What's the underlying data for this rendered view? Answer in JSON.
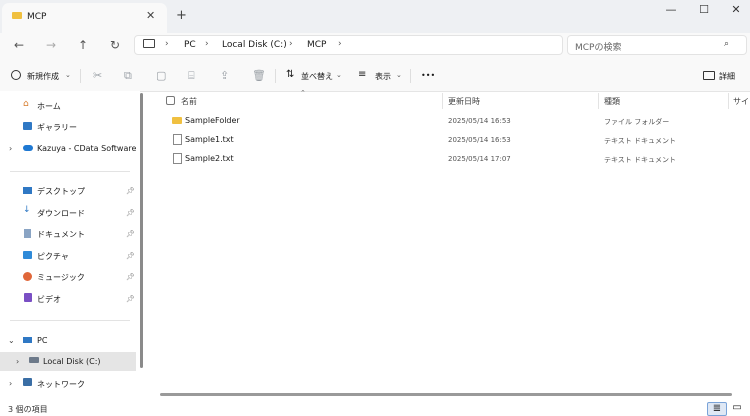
{
  "window": {
    "tab_title": "MCP",
    "new_tab": "+",
    "close_tab": "✕",
    "minimize": "—",
    "maximize": "☐",
    "close": "✕"
  },
  "nav": {
    "back": "←",
    "forward": "→",
    "up": "↑",
    "refresh": "↻"
  },
  "address": {
    "crumbs": [
      "PC",
      "Local Disk (C:)",
      "MCP"
    ],
    "search_placeholder": "MCPの検索"
  },
  "toolbar": {
    "new_label": "新規作成",
    "sort_label": "並べ替え",
    "view_label": "表示",
    "more_label": "•••",
    "details_label": "詳細"
  },
  "sidebar": {
    "items": [
      {
        "label": "ホーム",
        "icon": "home-icon"
      },
      {
        "label": "ギャラリー",
        "icon": "gallery-icon"
      },
      {
        "label": "Kazuya - CData Software",
        "icon": "cloud-icon"
      },
      {
        "label": "デスクトップ",
        "icon": "desktop-icon"
      },
      {
        "label": "ダウンロード",
        "icon": "download-icon"
      },
      {
        "label": "ドキュメント",
        "icon": "document-icon"
      },
      {
        "label": "ピクチャ",
        "icon": "pictures-icon"
      },
      {
        "label": "ミュージック",
        "icon": "music-icon"
      },
      {
        "label": "ビデオ",
        "icon": "video-icon"
      },
      {
        "label": "PC",
        "icon": "pc-icon"
      },
      {
        "label": "Local Disk (C:)",
        "icon": "drive-icon"
      },
      {
        "label": "ネットワーク",
        "icon": "network-icon"
      }
    ]
  },
  "file_list": {
    "columns": [
      "名前",
      "更新日時",
      "種類",
      "サイズ"
    ],
    "rows": [
      {
        "name": "SampleFolder",
        "modified": "2025/05/14 16:53",
        "type": "ファイル フォルダー"
      },
      {
        "name": "Sample1.txt",
        "modified": "2025/05/14 16:53",
        "type": "テキスト ドキュメント"
      },
      {
        "name": "Sample2.txt",
        "modified": "2025/05/14 17:07",
        "type": "テキスト ドキュメント"
      }
    ]
  },
  "status": {
    "item_count": "3 個の項目"
  },
  "colors": {
    "accent": "#0078d4",
    "folder": "#f0c040"
  }
}
